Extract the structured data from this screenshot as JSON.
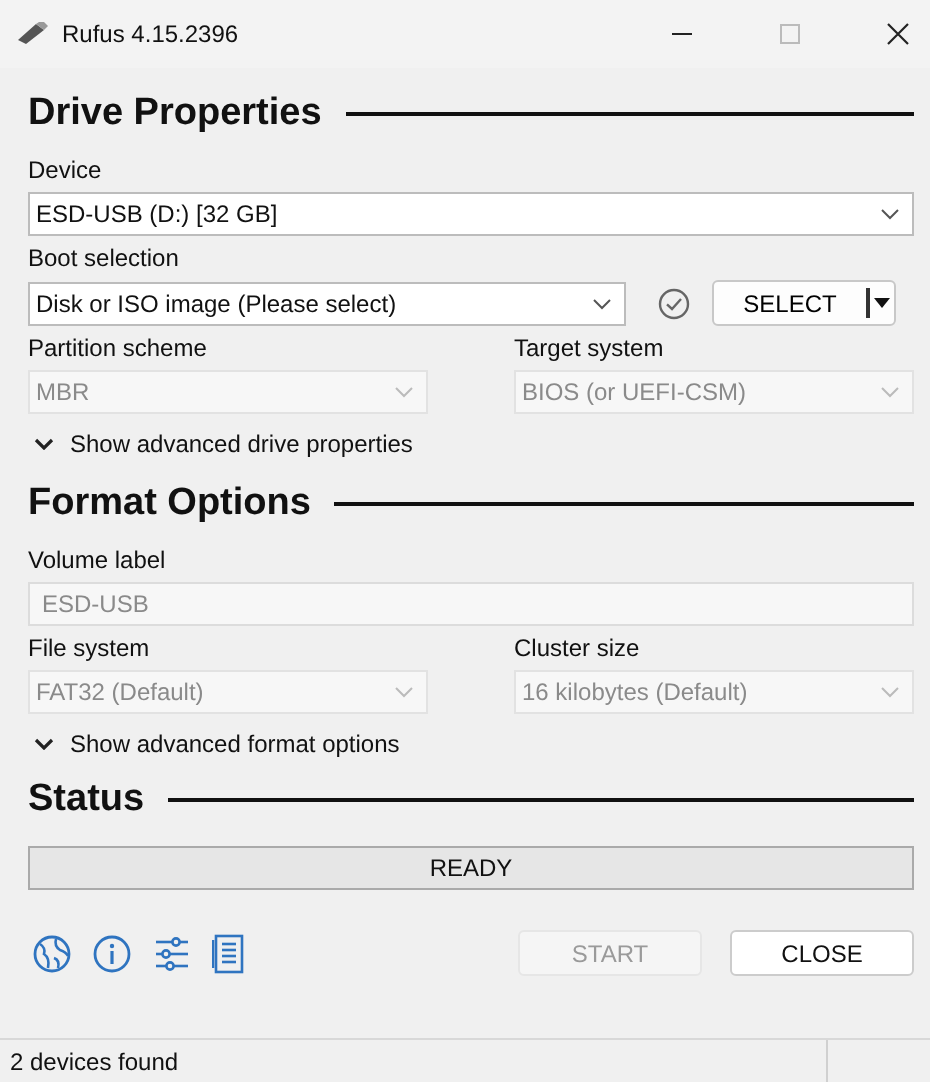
{
  "window": {
    "title": "Rufus 4.15.2396"
  },
  "drive_properties": {
    "heading": "Drive Properties",
    "device": {
      "label": "Device",
      "value": "ESD-USB (D:) [32 GB]",
      "disabled": false
    },
    "boot_selection": {
      "label": "Boot selection",
      "value": "Disk or ISO image (Please select)",
      "disabled": false
    },
    "select_button": {
      "label": "SELECT"
    },
    "partition_scheme": {
      "label": "Partition scheme",
      "value": "MBR",
      "disabled": true
    },
    "target_system": {
      "label": "Target system",
      "value": "BIOS (or UEFI-CSM)",
      "disabled": true
    },
    "advanced_toggle": {
      "label": "Show advanced drive properties",
      "expanded": false
    }
  },
  "format_options": {
    "heading": "Format Options",
    "volume_label": {
      "label": "Volume label",
      "value": "ESD-USB",
      "disabled": true
    },
    "file_system": {
      "label": "File system",
      "value": "FAT32 (Default)",
      "disabled": true
    },
    "cluster_size": {
      "label": "Cluster size",
      "value": "16 kilobytes (Default)",
      "disabled": true
    },
    "advanced_toggle": {
      "label": "Show advanced format options",
      "expanded": false
    }
  },
  "status": {
    "heading": "Status",
    "progress": {
      "text": "READY"
    }
  },
  "buttons": [
    {
      "label": "START",
      "disabled": true
    },
    {
      "label": "CLOSE",
      "disabled": false
    }
  ],
  "status_bar": {
    "text": "2 devices found"
  }
}
